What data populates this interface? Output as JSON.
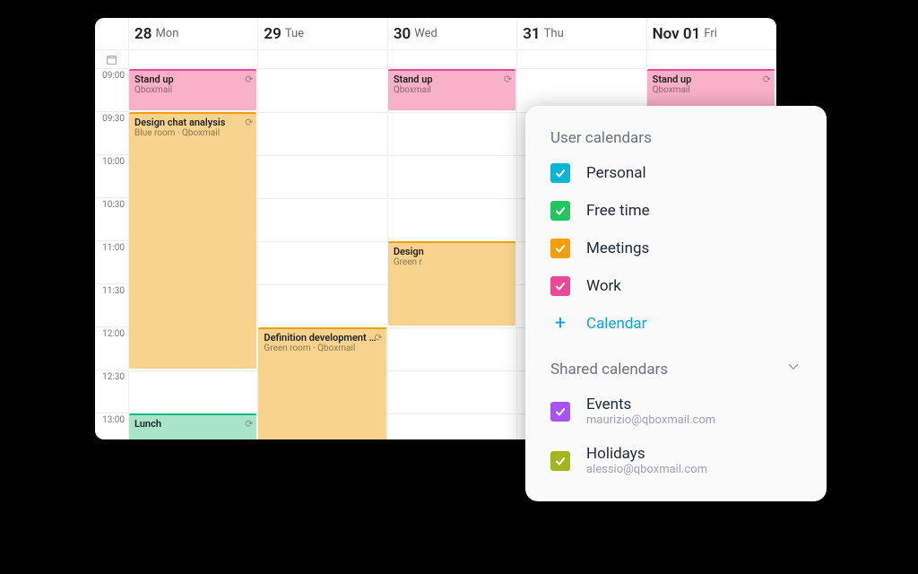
{
  "days": [
    {
      "num": "28",
      "dow": "Mon"
    },
    {
      "num": "29",
      "dow": "Tue"
    },
    {
      "num": "30",
      "dow": "Wed"
    },
    {
      "num": "31",
      "dow": "Thu"
    },
    {
      "num": "Nov 01",
      "dow": "Fri"
    }
  ],
  "timeSlots": [
    "09:00",
    "09:30",
    "10:00",
    "10:30",
    "11:00",
    "11:30",
    "12:00",
    "12:30",
    "13:00"
  ],
  "events": {
    "mon": {
      "standup": {
        "title": "Stand up",
        "loc": "Qboxmail"
      },
      "design": {
        "title": "Design chat analysis",
        "loc": "Blue room · Qboxmail"
      },
      "lunch": {
        "title": "Lunch",
        "loc": ""
      }
    },
    "tue": {
      "defdev": {
        "title": "Definition development p…",
        "loc": "Green room · Qboxmail"
      }
    },
    "wed": {
      "standup": {
        "title": "Stand up",
        "loc": "Qboxmail"
      },
      "design2": {
        "title": "Design",
        "loc": "Green r"
      }
    },
    "fri": {
      "standup": {
        "title": "Stand up",
        "loc": "Qboxmail"
      }
    }
  },
  "sidebar": {
    "userTitle": "User calendars",
    "sharedTitle": "Shared calendars",
    "addLabel": "Calendar",
    "user": [
      {
        "name": "Personal",
        "colorClass": "c-cyan"
      },
      {
        "name": "Free time",
        "colorClass": "c-green"
      },
      {
        "name": "Meetings",
        "colorClass": "c-amber"
      },
      {
        "name": "Work",
        "colorClass": "c-pink"
      }
    ],
    "shared": [
      {
        "name": "Events",
        "sub": "maurizio@qboxmail.com",
        "colorClass": "c-purple"
      },
      {
        "name": "Holidays",
        "sub": "alessio@qboxmail.com",
        "colorClass": "c-lime"
      }
    ]
  }
}
